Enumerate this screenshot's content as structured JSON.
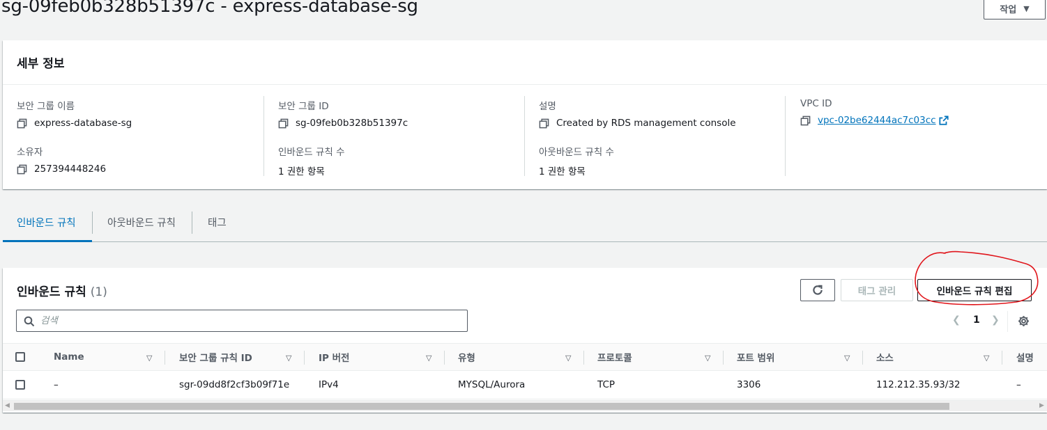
{
  "header": {
    "title": "sg-09feb0b328b51397c - express-database-sg",
    "actions_label": "작업"
  },
  "details": {
    "heading": "세부 정보",
    "sg_name_label": "보안 그룹 이름",
    "sg_name_value": "express-database-sg",
    "sg_id_label": "보안 그룹 ID",
    "sg_id_value": "sg-09feb0b328b51397c",
    "description_label": "설명",
    "description_value": "Created by RDS management console",
    "vpc_id_label": "VPC ID",
    "vpc_id_value": "vpc-02be62444ac7c03cc",
    "owner_label": "소유자",
    "owner_value": "257394448246",
    "inbound_count_label": "인바운드 규칙 수",
    "inbound_count_value": "1 권한 항목",
    "outbound_count_label": "아웃바운드 규칙 수",
    "outbound_count_value": "1 권한 항목"
  },
  "tabs": [
    {
      "label": "인바운드 규칙",
      "active": true
    },
    {
      "label": "아웃바운드 규칙",
      "active": false
    },
    {
      "label": "태그",
      "active": false
    }
  ],
  "rules": {
    "title": "인바운드 규칙",
    "count": "(1)",
    "manage_tags_label": "태그 관리",
    "edit_rules_label": "인바운드 규칙 편집",
    "search_placeholder": "검색",
    "page": "1",
    "columns": [
      "Name",
      "보안 그룹 규칙 ID",
      "IP 버전",
      "유형",
      "프로토콜",
      "포트 범위",
      "소스",
      "설명"
    ],
    "rows": [
      {
        "name": "–",
        "rule_id": "sgr-09dd8f2cf3b09f71e",
        "ip_version": "IPv4",
        "type": "MYSQL/Aurora",
        "protocol": "TCP",
        "port_range": "3306",
        "source": "112.212.35.93/32",
        "description": "–"
      }
    ]
  },
  "icons": {
    "copy": "copy-icon",
    "external_link": "external-link-icon",
    "refresh": "refresh-icon",
    "search": "search-icon",
    "settings": "gear-icon",
    "sort": "sort-down-icon"
  },
  "colors": {
    "link": "#0073bb",
    "annotation": "#e0141a",
    "background": "#f2f3f3"
  }
}
